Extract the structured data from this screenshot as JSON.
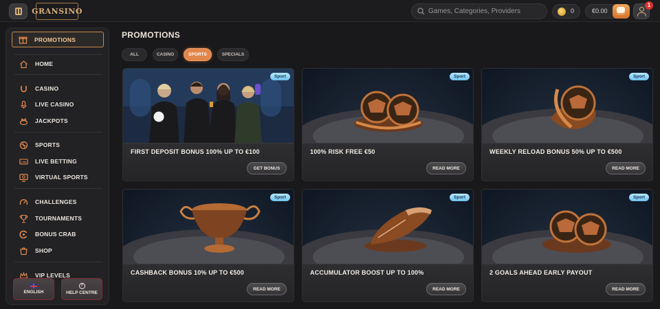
{
  "topbar": {
    "logo_text": "GRANSINO",
    "search_placeholder": "Games, Categories, Providers",
    "coins_value": "0",
    "balance": "€0.00",
    "notification_count": "1"
  },
  "sidebar": {
    "items": [
      {
        "label": "PROMOTIONS",
        "icon": "gift-icon",
        "active": true
      },
      {
        "label": "HOME",
        "icon": "home-icon"
      },
      {
        "label": "CASINO",
        "icon": "horseshoe-icon"
      },
      {
        "label": "LIVE CASINO",
        "icon": "microphone-icon"
      },
      {
        "label": "JACKPOTS",
        "icon": "jackpot-icon"
      },
      {
        "label": "SPORTS",
        "icon": "ball-icon"
      },
      {
        "label": "LIVE BETTING",
        "icon": "live-icon"
      },
      {
        "label": "VIRTUAL SPORTS",
        "icon": "monitor-icon"
      },
      {
        "label": "CHALLENGES",
        "icon": "challenge-icon"
      },
      {
        "label": "TOURNAMENTS",
        "icon": "trophy-icon"
      },
      {
        "label": "BONUS CRAB",
        "icon": "crab-icon"
      },
      {
        "label": "SHOP",
        "icon": "shop-icon"
      },
      {
        "label": "VIP LEVELS",
        "icon": "crown-icon"
      }
    ],
    "language_label": "ENGLISH",
    "help_label": "HELP CENTRE"
  },
  "main": {
    "title": "PROMOTIONS",
    "tabs": [
      {
        "label": "ALL",
        "active": false
      },
      {
        "label": "CASINO",
        "active": false
      },
      {
        "label": "SPORTS",
        "active": true
      },
      {
        "label": "SPECIALS",
        "active": false
      }
    ],
    "cards": [
      {
        "title": "FIRST DEPOSIT BONUS 100% UP TO €100",
        "badge": "Sport",
        "cta": "GET BONUS",
        "art": "players"
      },
      {
        "title": "100% RISK FREE €50",
        "badge": "Sport",
        "cta": "READ MORE",
        "art": "two-balls"
      },
      {
        "title": "WEEKLY RELOAD BONUS 50% UP TO €500",
        "badge": "Sport",
        "cta": "READ MORE",
        "art": "ball-swirl"
      },
      {
        "title": "CASHBACK BONUS 10% UP TO €500",
        "badge": "Sport",
        "cta": "READ MORE",
        "art": "trophy-cup"
      },
      {
        "title": "ACCUMULATOR BOOST UP TO 100%",
        "badge": "Sport",
        "cta": "READ MORE",
        "art": "boot"
      },
      {
        "title": "2 GOALS AHEAD EARLY PAYOUT",
        "badge": "Sport",
        "cta": "READ MORE",
        "art": "two-balls"
      }
    ]
  },
  "colors": {
    "accent": "#e2864a",
    "gold": "#d9b07c",
    "badge": "#8fd3f7",
    "background": "#19191b"
  }
}
